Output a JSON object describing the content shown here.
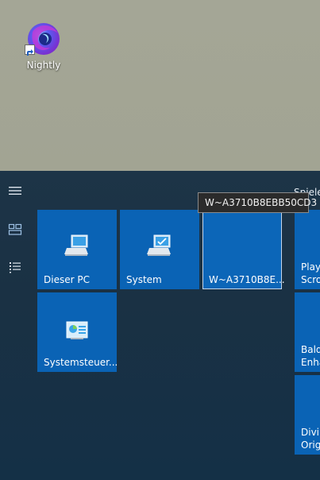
{
  "desktop": {
    "icons": [
      {
        "label": "Nightly",
        "icon": "firefox-nightly-icon"
      }
    ]
  },
  "start_menu": {
    "rail": [
      {
        "name": "menu",
        "icon": "hamburger-icon"
      },
      {
        "name": "tiles",
        "icon": "tiles-view-icon"
      },
      {
        "name": "all-apps",
        "icon": "list-view-icon"
      }
    ],
    "group_header": "Spiele",
    "tiles": [
      {
        "label": "Dieser PC",
        "icon": "computer-icon"
      },
      {
        "label": "System",
        "icon": "computer-check-icon"
      },
      {
        "label": "W~A3710B8E..."
      },
      {
        "label": "Systemsteuer...",
        "icon": "control-panel-icon"
      }
    ],
    "side_tiles": [
      {
        "label": "Play\nScro"
      },
      {
        "label": "Bald\nEnha"
      },
      {
        "label": "Divin\nOrigi"
      }
    ]
  },
  "tooltip": "W~A3710B8EBB50CD3",
  "colors": {
    "desktop_bg": "#a3a594",
    "start_bg": "#1a3144",
    "tile_bg": "#0a63b5",
    "tooltip_bg": "#2b2b2b"
  }
}
